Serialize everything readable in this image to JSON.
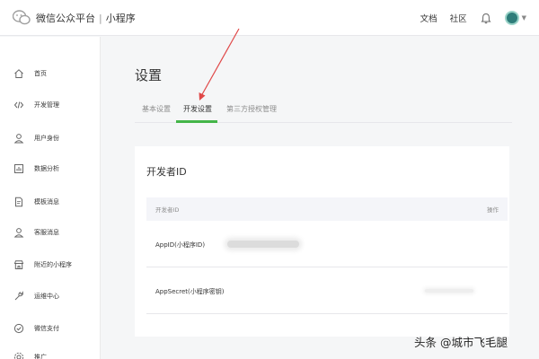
{
  "topbar": {
    "brand": "微信公众平台",
    "separator": "|",
    "product": "小程序",
    "links": [
      "文档",
      "社区"
    ]
  },
  "sidebar": {
    "items": [
      {
        "label": "首页",
        "icon": "home-icon"
      },
      {
        "label": "开发管理",
        "icon": "code-icon"
      },
      {
        "label": "用户身份",
        "icon": "user-icon"
      },
      {
        "label": "数据分析",
        "icon": "chart-icon"
      },
      {
        "label": "模板消息",
        "icon": "document-icon"
      },
      {
        "label": "客服消息",
        "icon": "user-icon"
      },
      {
        "label": "附近的小程序",
        "icon": "store-icon"
      },
      {
        "label": "运维中心",
        "icon": "wrench-icon"
      },
      {
        "label": "微信支付",
        "icon": "check-circle-icon"
      },
      {
        "label": "推广",
        "icon": "settings-icon"
      }
    ]
  },
  "main": {
    "title": "设置",
    "tabs": [
      {
        "label": "基本设置",
        "active": false
      },
      {
        "label": "开发设置",
        "active": true
      },
      {
        "label": "第三方授权管理",
        "active": false
      }
    ]
  },
  "card": {
    "title": "开发者ID",
    "table": {
      "columns": [
        "开发者ID",
        "操作"
      ],
      "rows": [
        {
          "label": "AppID(小程序ID)",
          "value_redacted": true
        },
        {
          "label": "AppSecret(小程序密钥)",
          "value_redacted": true
        }
      ]
    }
  },
  "watermark": "头条 @城市飞毛腿",
  "colors": {
    "accent_green": "#44b549",
    "annotation_arrow": "#e04848"
  }
}
